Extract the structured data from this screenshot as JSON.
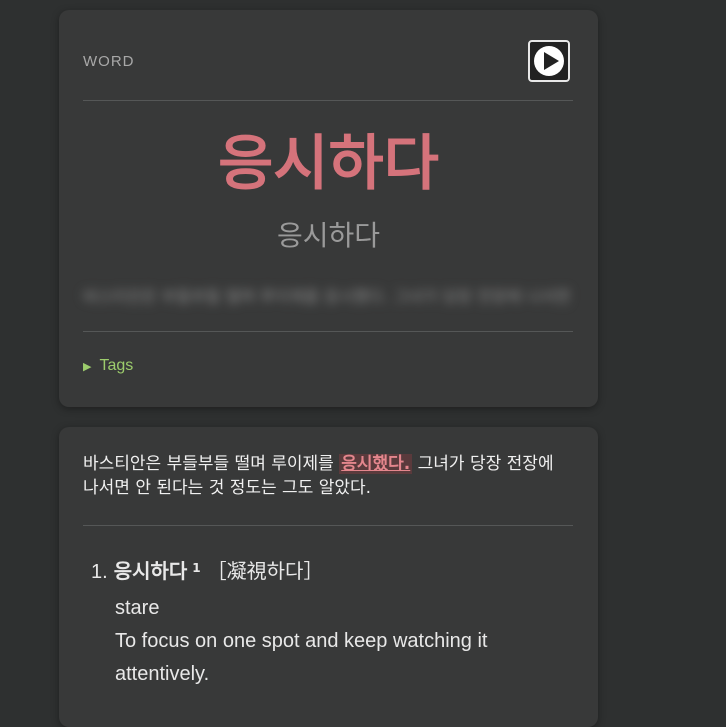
{
  "card": {
    "label": "WORD",
    "headword": "응시하다",
    "reading": "응시하다",
    "blurred_sentence": "바스티안은 부들부들 떨며 루이제를 응시했다. 그녀가 당장 전장에 나서면",
    "tags_label": "Tags",
    "play_icon": "play-icon"
  },
  "example": {
    "before": "바스티안은 부들부들 떨며 루이제를 ",
    "highlight": "응시했다.",
    "after": " 그녀가 당장 전장에 나서면 안 된다는 것 정도는 그도 알았다."
  },
  "definitions": [
    {
      "number": "1.",
      "word": "응시하다",
      "superscript": "1",
      "hanja": "［凝視하다］",
      "translation": "stare",
      "meaning": "To focus on one spot and keep watching it attentively."
    }
  ],
  "colors": {
    "background": "#2e3030",
    "card": "#383939",
    "accent": "#d5737b",
    "tags": "#9ccc6c"
  }
}
